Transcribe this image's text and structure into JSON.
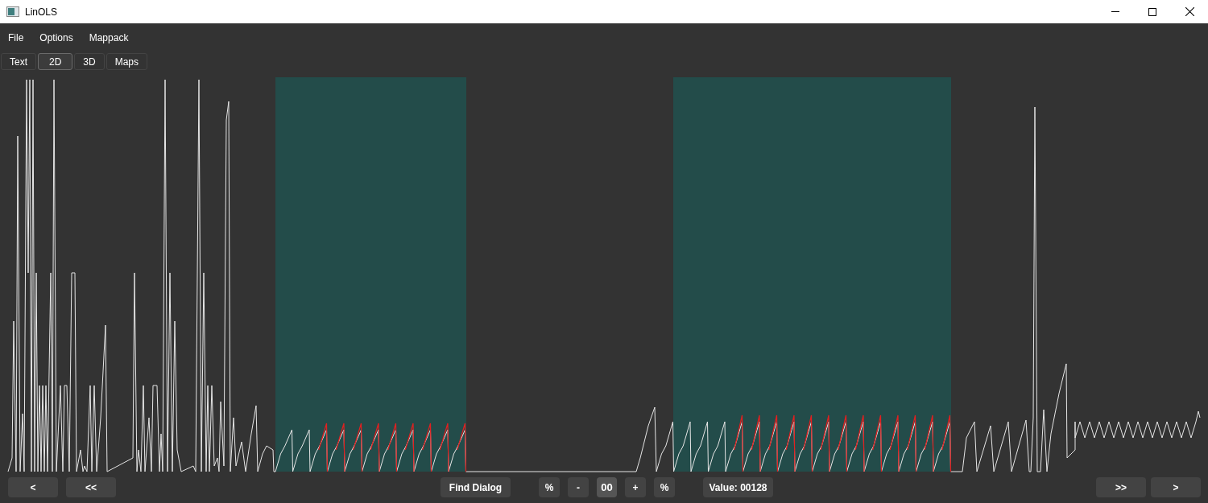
{
  "window": {
    "title": "LinOLS"
  },
  "menu": [
    "File",
    "Options",
    "Mappack"
  ],
  "tabs": [
    {
      "label": "Text",
      "selected": false
    },
    {
      "label": "2D",
      "selected": true
    },
    {
      "label": "3D",
      "selected": false
    },
    {
      "label": "Maps",
      "selected": false
    }
  ],
  "bottom_bar": {
    "left": [
      "<",
      "<<"
    ],
    "center": [
      {
        "label": "Find Dialog",
        "kind": "button"
      },
      {
        "label": "%",
        "kind": "small"
      },
      {
        "label": "-",
        "kind": "small"
      },
      {
        "label": "00",
        "kind": "field"
      },
      {
        "label": "+",
        "kind": "small"
      },
      {
        "label": "%",
        "kind": "small"
      },
      {
        "label": "Value: 00128",
        "kind": "readout"
      }
    ],
    "right": [
      ">>",
      ">"
    ]
  }
}
